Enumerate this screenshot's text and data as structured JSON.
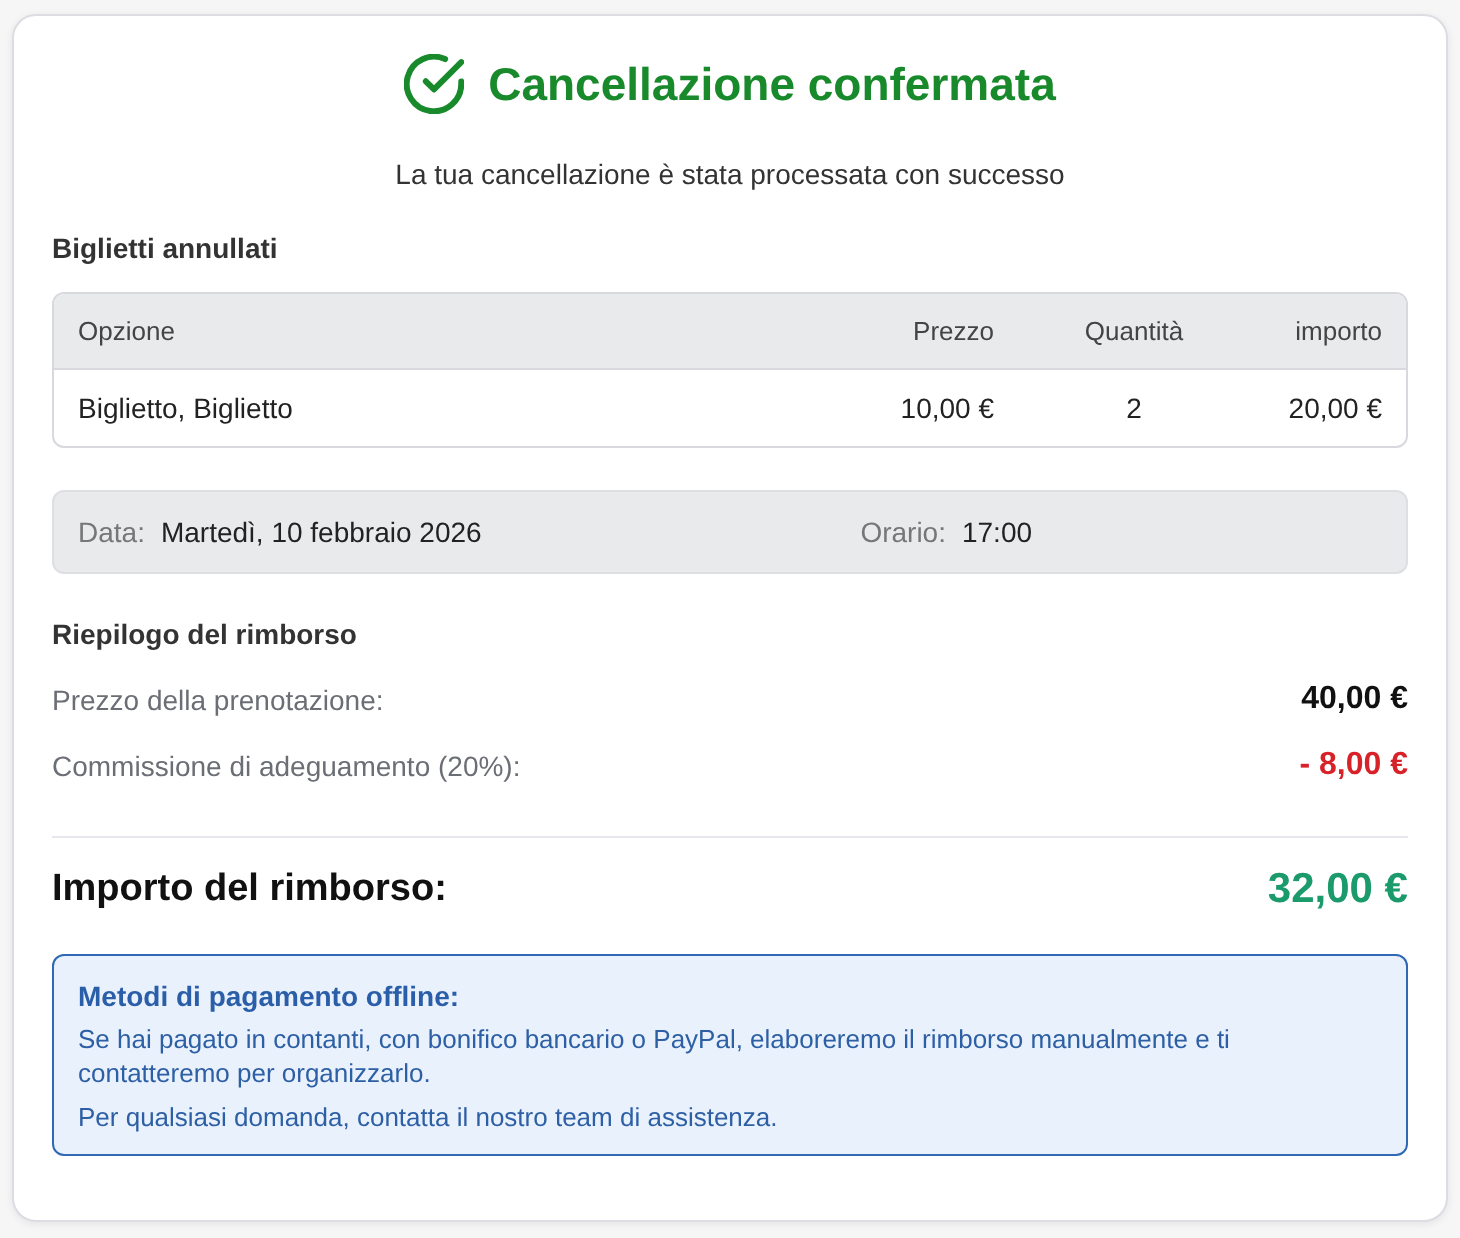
{
  "header": {
    "title": "Cancellazione confermata",
    "subtitle": "La tua cancellazione è stata processata con successo"
  },
  "tickets": {
    "heading": "Biglietti annullati",
    "columns": [
      "Opzione",
      "Prezzo",
      "Quantità",
      "importo"
    ],
    "rows": [
      [
        "Biglietto, Biglietto",
        "10,00 €",
        "2",
        "20,00 €"
      ]
    ]
  },
  "schedule": [
    {
      "label": "Data:",
      "value": "Martedì, 10 febbraio 2026"
    },
    {
      "label": "Orario:",
      "value": "17:00"
    }
  ],
  "refund_summary": {
    "heading": "Riepilogo del rimborso",
    "lines": [
      {
        "kind": "charge",
        "label": "Prezzo della prenotazione:",
        "value": "40,00 €"
      },
      {
        "kind": "deduction",
        "label": "Commissione di adeguamento (20%):",
        "value": "- 8,00 €"
      }
    ]
  },
  "refund_total": {
    "label": "Importo del rimborso:",
    "value": "32,00 €"
  },
  "notice": {
    "title": "Metodi di pagamento offline:",
    "paragraphs": [
      "Se hai pagato in contanti, con bonifico bancario o PayPal, elaboreremo il rimborso manualmente e ti contatteremo per organizzarlo.",
      "Per qualsiasi domanda, contatta il nostro team di assistenza."
    ]
  }
}
